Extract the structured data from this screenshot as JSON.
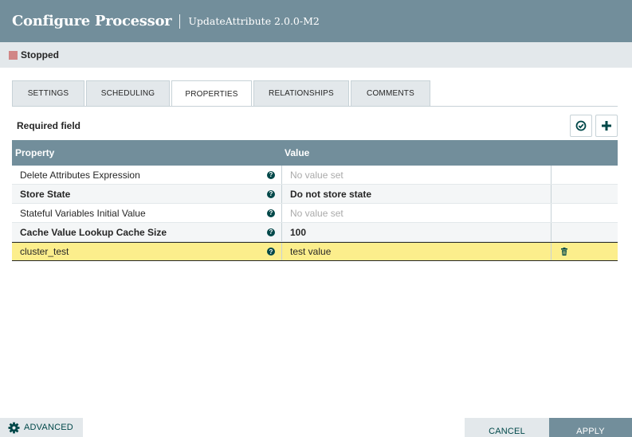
{
  "header": {
    "title": "Configure Processor",
    "subtitle": "UpdateAttribute 2.0.0-M2"
  },
  "status": {
    "text": "Stopped",
    "color": "#d18686"
  },
  "tabs": [
    {
      "label": "SETTINGS",
      "active": false
    },
    {
      "label": "SCHEDULING",
      "active": false
    },
    {
      "label": "PROPERTIES",
      "active": true
    },
    {
      "label": "RELATIONSHIPS",
      "active": false
    },
    {
      "label": "COMMENTS",
      "active": false
    }
  ],
  "required_label": "Required field",
  "table": {
    "columns": [
      "Property",
      "Value"
    ],
    "rows": [
      {
        "property": "Delete Attributes Expression",
        "value": "No value set",
        "required": false,
        "empty": true
      },
      {
        "property": "Store State",
        "value": "Do not store state",
        "required": true,
        "empty": false
      },
      {
        "property": "Stateful Variables Initial Value",
        "value": "No value set",
        "required": false,
        "empty": true
      },
      {
        "property": "Cache Value Lookup Cache Size",
        "value": "100",
        "required": true,
        "empty": false
      },
      {
        "property": "cluster_test",
        "value": "test value",
        "required": false,
        "empty": false,
        "selected": true,
        "deletable": true
      }
    ]
  },
  "footer": {
    "advanced_label": "ADVANCED",
    "cancel_label": "CANCEL",
    "apply_label": "APPLY"
  },
  "colors": {
    "header": "#728e9b",
    "accent": "#004849",
    "selected_row": "#fcee8c"
  }
}
